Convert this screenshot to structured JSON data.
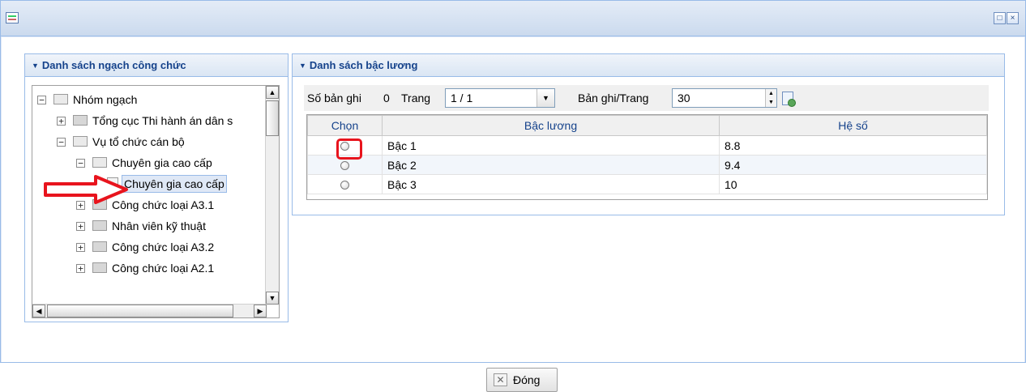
{
  "window": {
    "restore_glyph": "□",
    "close_glyph": "×"
  },
  "left_panel": {
    "title": "Danh sách ngạch công chức",
    "tree": [
      {
        "label": "Nhóm ngạch",
        "expander": "−",
        "icon": "folder-open"
      },
      {
        "label": "Tổng cục Thi hành án dân s",
        "expander": "+",
        "icon": "folder"
      },
      {
        "label": "Vụ tổ chức cán bộ",
        "expander": "−",
        "icon": "folder-open"
      },
      {
        "label": "Chuyên gia cao cấp",
        "expander": "−",
        "icon": "folder-open"
      },
      {
        "label": "Chuyên gia cao cấp",
        "expander": "",
        "icon": "leaf",
        "selected": true
      },
      {
        "label": "Công chức loại A3.1",
        "expander": "+",
        "icon": "folder"
      },
      {
        "label": "Nhân viên kỹ thuật",
        "expander": "+",
        "icon": "folder"
      },
      {
        "label": "Công chức loại A3.2",
        "expander": "+",
        "icon": "folder"
      },
      {
        "label": "Công chức loại A2.1",
        "expander": "+",
        "icon": "folder"
      }
    ]
  },
  "right_panel": {
    "title": "Danh sách bậc lương",
    "toolbar": {
      "record_count_label": "Số bản ghi",
      "record_count": "0",
      "page_label": "Trang",
      "page_value": "1 / 1",
      "per_page_label": "Bản ghi/Trang",
      "per_page_value": "30"
    },
    "grid": {
      "columns": [
        "Chọn",
        "Bậc lương",
        "Hệ số"
      ],
      "rows": [
        {
          "level": "Bậc 1",
          "coefficient": "8.8"
        },
        {
          "level": "Bậc 2",
          "coefficient": "9.4"
        },
        {
          "level": "Bậc 3",
          "coefficient": "10"
        }
      ]
    }
  },
  "footer": {
    "close_label": "Đóng"
  },
  "colors": {
    "accent": "#15428b",
    "annotation_red": "#e8141d",
    "border": "#99bbe8"
  }
}
